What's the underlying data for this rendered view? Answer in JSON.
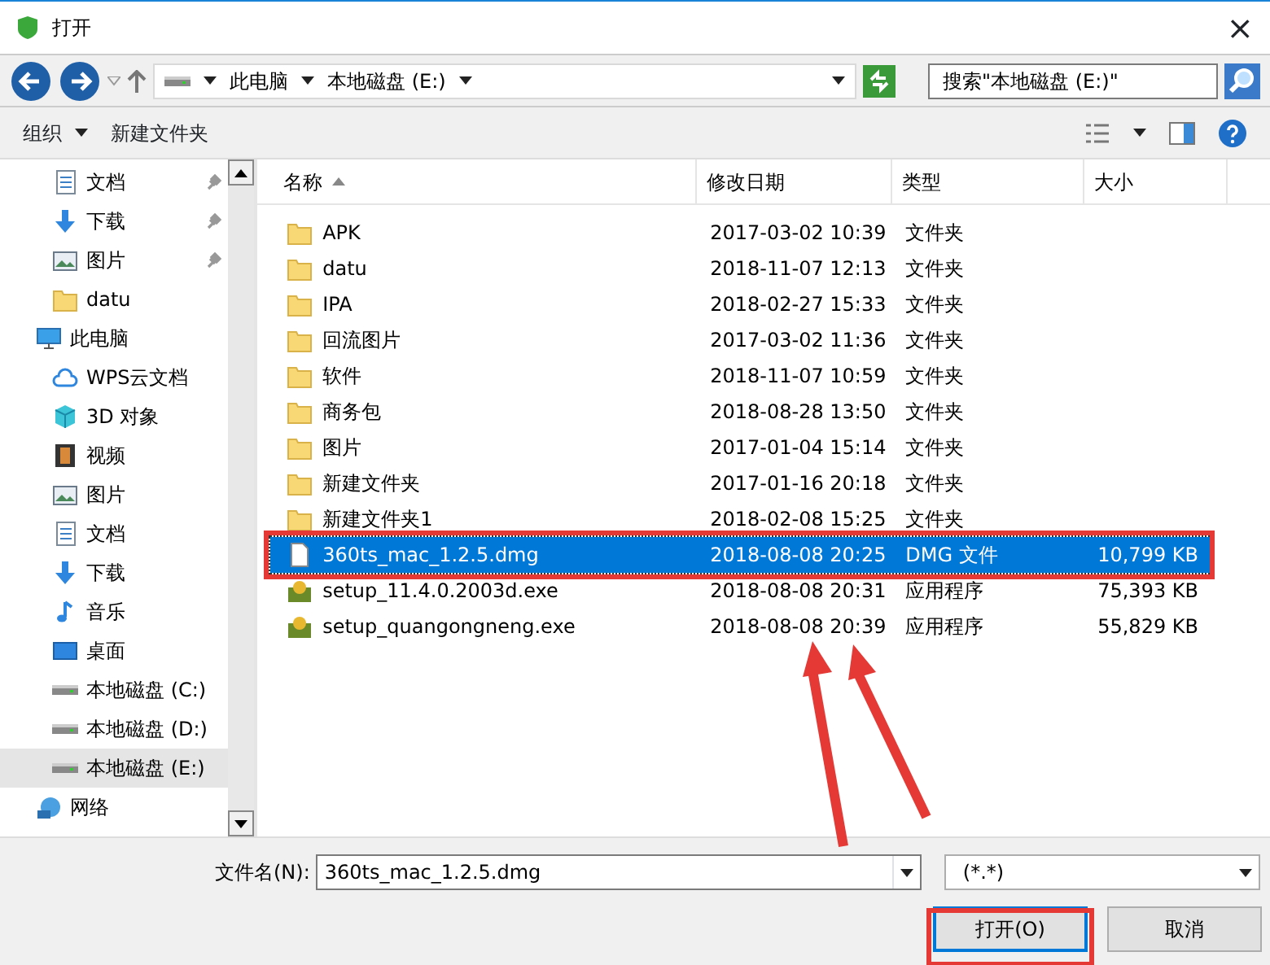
{
  "window": {
    "title": "打开",
    "close": "×"
  },
  "address": {
    "crumbs": [
      "此电脑",
      "本地磁盘 (E:)"
    ],
    "search_placeholder": "搜索\"本地磁盘 (E:)\""
  },
  "toolbar": {
    "organize": "组织",
    "new_folder": "新建文件夹"
  },
  "sidebar": {
    "quick_access": [
      {
        "label": "文档",
        "kind": "doc",
        "pinned": true,
        "selected": false
      },
      {
        "label": "下载",
        "kind": "download",
        "pinned": true,
        "selected": false
      },
      {
        "label": "图片",
        "kind": "picture",
        "pinned": true,
        "selected": false
      },
      {
        "label": "datu",
        "kind": "folder",
        "pinned": false,
        "selected": false
      }
    ],
    "tree": [
      {
        "label": "此电脑",
        "kind": "pc",
        "selected": false,
        "children": [
          {
            "label": "WPS云文档",
            "kind": "cloud",
            "selected": false
          },
          {
            "label": "3D 对象",
            "kind": "cube",
            "selected": false
          },
          {
            "label": "视频",
            "kind": "video",
            "selected": false
          },
          {
            "label": "图片",
            "kind": "picture",
            "selected": false
          },
          {
            "label": "文档",
            "kind": "doc",
            "selected": false
          },
          {
            "label": "下载",
            "kind": "download",
            "selected": false
          },
          {
            "label": "音乐",
            "kind": "music",
            "selected": false
          },
          {
            "label": "桌面",
            "kind": "desktop",
            "selected": false
          },
          {
            "label": "本地磁盘 (C:)",
            "kind": "drive",
            "selected": false
          },
          {
            "label": "本地磁盘 (D:)",
            "kind": "drive",
            "selected": false
          },
          {
            "label": "本地磁盘 (E:)",
            "kind": "drive",
            "selected": true
          }
        ]
      },
      {
        "label": "网络",
        "kind": "network",
        "selected": false
      }
    ]
  },
  "table": {
    "columns": [
      "名称",
      "修改日期",
      "类型",
      "大小"
    ],
    "rows": [
      {
        "name": "APK",
        "date": "2017-03-02 10:39",
        "type": "文件夹",
        "kind": "folder",
        "selected": false
      },
      {
        "name": "datu",
        "date": "2018-11-07 12:13",
        "type": "文件夹",
        "kind": "folder",
        "selected": false
      },
      {
        "name": "IPA",
        "date": "2018-02-27 15:33",
        "type": "文件夹",
        "kind": "folder",
        "selected": false
      },
      {
        "name": "回流图片",
        "date": "2017-03-02 11:36",
        "type": "文件夹",
        "kind": "folder",
        "selected": false
      },
      {
        "name": "软件",
        "date": "2018-11-07 10:59",
        "type": "文件夹",
        "kind": "folder",
        "selected": false
      },
      {
        "name": "商务包",
        "date": "2018-08-28 13:50",
        "type": "文件夹",
        "kind": "folder",
        "selected": false
      },
      {
        "name": "图片",
        "date": "2017-01-04 15:14",
        "type": "文件夹",
        "kind": "folder",
        "selected": false
      },
      {
        "name": "新建文件夹",
        "date": "2017-01-16 20:18",
        "type": "文件夹",
        "kind": "folder",
        "selected": false
      },
      {
        "name": "新建文件夹1",
        "date": "2018-02-08 15:25",
        "type": "文件夹",
        "kind": "folder",
        "selected": false
      },
      {
        "name": "360ts_mac_1.2.5.dmg",
        "date": "2018-08-08 20:25",
        "type": "DMG 文件",
        "size": "10,799 KB",
        "kind": "file",
        "selected": true
      },
      {
        "name": "setup_11.4.0.2003d.exe",
        "date": "2018-08-08 20:31",
        "type": "应用程序",
        "size": "75,393 KB",
        "kind": "exe",
        "selected": false
      },
      {
        "name": "setup_quangongneng.exe",
        "date": "2018-08-08 20:39",
        "type": "应用程序",
        "size": "55,829 KB",
        "kind": "exe",
        "selected": false
      }
    ]
  },
  "footer": {
    "filename_label": "文件名(N):",
    "filename": "360ts_mac_1.2.5.dmg",
    "filetype": "(*.*)",
    "open": "打开(O)",
    "cancel": "取消"
  }
}
